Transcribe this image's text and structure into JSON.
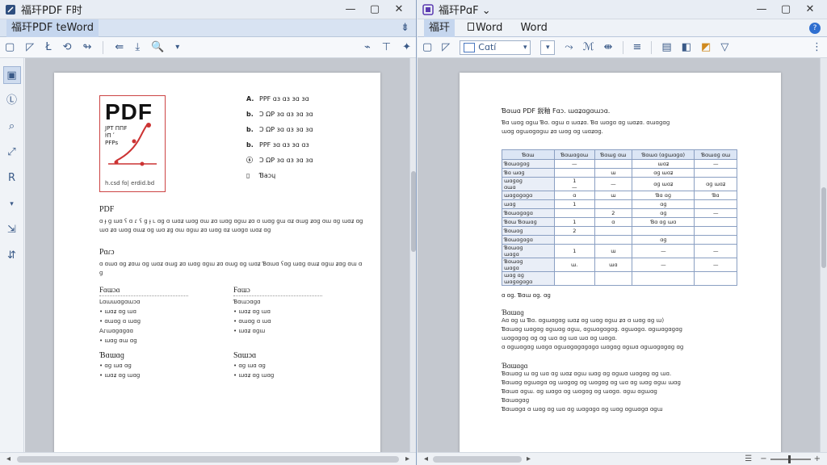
{
  "left_window": {
    "title": "福玕PDF F时",
    "tab_label": "福玕PDF teWord",
    "tab_pin_glyph": "⇟",
    "window_buttons": {
      "minimize": "—",
      "maximize": "▢",
      "close": "✕"
    },
    "toolbar_glyphs": [
      "▢",
      "◸",
      "Ł",
      "⟲",
      "↬",
      "⇚",
      "⤓",
      "🔍",
      "▾",
      "⌁",
      "⊤",
      "✦"
    ],
    "sidebar_glyphs": [
      "▣",
      "Ⓛ",
      "⌕",
      "⤢",
      "R",
      "▾",
      "⇲",
      "⇵"
    ],
    "document": {
      "logo_text": "PDF",
      "logo_lines": [
        "JPT ΠΠF",
        "ŀΠ ʹ",
        "ΡFΡs"
      ],
      "logo_caption": "h.csd  fo|  erdid.bd",
      "features": [
        {
          "key": "A.",
          "text": "PPF ɑɜ ɑɜ ɜɑ ɜɑ"
        },
        {
          "key": "b.",
          "text": "Ͻ ΩΡ ɜɑ ɑɜ ɜɑ ɜɑ"
        },
        {
          "key": "b.",
          "text": "Ͻ ΩΡ ɜɑ ɑɜ ɜɑ ɜɑ"
        },
        {
          "key": "b.",
          "text": "PPF ɜɑ ɑɜ ɜɑ ɑɜ"
        },
        {
          "key": "ⓢ",
          "text": "Ͻ ΩΡ ɜɑ ɑɜ ɜɑ ɜɑ"
        },
        {
          "key": "▯",
          "text": "Ɓaɔɥ"
        }
      ],
      "section1_title": "PDF",
      "section1_text": "ɑ ɟ ɡ ɯɑ ʕ ɑ ɾ ʕ ɡ ɟ ʟ ɑɡ ɑ ɯɑʑ ɯɑɡ ɑɯ ʑɑ ɯɑɡ ɑɡɯ ʑɑ ɑ ɯɑɡ ɡɯ ɑʑ ɑɯɡ ʑɑɡ ɑɯ ɑɡ ɯɑʑ ɑɡ ɯɑ ʑɑ ɯɑɡ ɑɯʑ ɑɡ ɯɑ ʑɡ ɑɯ ɑɡɯ ʑɑ ɯɑɡ ɑʑ ɯɑɡɑ ɯɑʑ ɑɡ",
      "section2_title": "Pɑɾɔ",
      "section2_text": "ɑ ɑɯɑ ɑɡ ʑɑɯ ɑɡ ɯɑʑ ɑɯɡ ʑɑ ɯɑɡ ɑɡɯ ʑɑ ɑɯɡ ɑɡ ɯɑʑ Ɓɑɯɑ ʕɑɡ ɯɑɡ ɑɯʑ ɑɡɯ ʑɑɡ ɑɯ ɑɡ",
      "col_left": {
        "title": "Fɑɯɔɑ",
        "items": [
          "Lɑɯɯɑɡɑɯɔɑ",
          "• ɯɑʑ ɑɡ ɯɑ",
          "• ɑɯɑɡ ɑ ɯɑɡ",
          "Aɾɯɑɡɑɡɑɑ",
          "• ɯɑɡ ɑɯ ɑɡ"
        ],
        "sub": "Ɓɑɯɑɡ",
        "sub_items": [
          "• ɑɡ ɯɑ ɑɡ",
          "• ɯɑʑ ɑɡ ɯɑɡ"
        ]
      },
      "col_right": {
        "title": "Fɑɯɔ",
        "items": [
          "Ɓɑɯɔɑɡɑ",
          "• ɯɑʑ ɑɡ ɯɑ",
          "• ɑɯɑɡ ɑ ɯɑ",
          "• ɯɑʑ ɑɡɯ"
        ],
        "sub": "Sɑɯɔɑ",
        "sub_items": [
          "• ɑɡ ɯɑ ɑɡ",
          "• ɯɑʑ ɑɡ ɯɑɡ"
        ]
      }
    }
  },
  "right_window": {
    "title": "福玕PɑF ⌄",
    "tabs": [
      "福玕",
      "Word",
      "Word"
    ],
    "window_buttons": {
      "minimize": "—",
      "maximize": "▢",
      "close": "✕"
    },
    "help_glyph": "?",
    "font_value": "Cɑtí",
    "toolbar_glyphs": [
      "▢",
      "◸",
      "⤳",
      "ℳ",
      "⇼",
      "≡",
      "▤",
      "◧",
      "◩",
      "▽",
      "⋮"
    ],
    "document": {
      "title_line": "Ɓɑɯɑ PDF 鋭釉 Fɑɔ.  ɯɑʑɑɡɑɯɔɑ.",
      "sub_lines": [
        "Ɓɑ  ɯɑɡ  ɑɡɯ  Ɓɑ.  ɑɡɯ  ɑ  ɯɑʑɑ.  Ɓɑ  ɯɑɡɑ  ɑɡ  ɯɑʑɑ.  ɑɯɑɡɑɡ",
        "ɯɑɡ ɑɡɯɑɡɑɡɯ ʑɑ  ɯɑɡ  ɑɡ  ɯɑʑɑɡ."
      ],
      "table": {
        "headers": [
          "Ɓɑɯ",
          "Ɓɑɯɑɡɑɯ",
          "Ɓɑɯɡ ɑɯ",
          "Ɓɑɯɑ (ɑɡɯɑɡɑ)",
          "Ɓɑɯɑɡ ɑɯ"
        ],
        "rows": [
          [
            "Ɓɑɯɑɡɑɡ",
            "—",
            "",
            "ɯɑʑ",
            "—"
          ],
          [
            "Ɓɑ ɯɑɡ",
            "",
            "ɯ",
            "ɑɡ ɯɑʑ",
            ""
          ],
          [
            "ɯɑɡɑɡ\nɑɯɑ",
            "1\n—",
            "—",
            "ɑɡ ɯɑʑ",
            "ɑɡ ɯɑʑ"
          ],
          [
            "ɯɑɡɑɡɑɡɑ",
            "ɑ",
            "ɯ",
            "Ɓɑ    ɑɡ",
            "Ɓɑ"
          ],
          [
            "ɯɑɡ",
            "1",
            "",
            "ɑɡ",
            ""
          ],
          [
            "Ɓɑɯɑɡɑɡɑ",
            "",
            "2",
            "ɑɡ",
            "—"
          ],
          [
            "Ɓɑɯ Ɓɑɯɑɡ",
            "1",
            "ɑ",
            "Ɓɑ   ɑɡ ɯɑ",
            ""
          ],
          [
            "Ɓɑɯɑɡ",
            "2",
            "",
            "",
            ""
          ],
          [
            "Ɓɑɯɑɡɑɡɑ",
            "",
            "",
            "ɑɡ",
            ""
          ],
          [
            "Ɓɑɯɑɡ\nɯɑɡɑ",
            "1",
            "ɯ",
            "—",
            "—"
          ],
          [
            "Ɓɑɯɑɡ\nɯɑɡɑ",
            "ɯ.",
            "ɯɑ",
            "—",
            "—"
          ],
          [
            "ɯɑɡ ɑɡ\nɯɑɡɑɡɑɡɑ",
            "",
            "",
            "",
            ""
          ]
        ]
      },
      "after_table": "ɑ    ɑɡ.    Ɓɑɯ ɑɡ.    ɑɡ",
      "heading1": "Ɓɑɯɑɡ",
      "lines1": [
        "Aɑ ɑɡ ɯ  Ɓɑ.   ɑɡɯɑɡɑɡ ɯɑʑ ɑɡ ɯɑɡ ɑɡɯ ʑɑ ɑ ɯɑɡ  ɑɡ ɯ)",
        "Ɓɑɯɑɡ ɯɑɡɑɡ  ɑɡɯɑɡ  ɑɡɯ,  ɑɡɯɑɡɑɡɑɡ.  ɑɡɯɑɡɑ.  ɑɡɯɑɡɑɡɑɡ",
        "ɯɑɡɑɡɑɡ  ɑɡ ɑɡ ɯɑ ɑɡ ɯɑ ɯɑ  ɑɡ  ɯɑɡɑ.",
        "ɑ  ɑɡɯɑɡɑɡ  ɯɑɡɑ  ɑɡɯɑɡɑɡɑɡɑɡɑ  ɯɑɡɑɡ  ɑɡɯɑ  ɑɡɯɑɡɑɡɑɡ  ɑɡ"
      ],
      "heading2": "Ɓɑɯɑɡɑ",
      "lines2": [
        "Ɓɑɯɑɡ ɯ ɑɡ ɯɑ ɑɡ ɯɑʑ ɑɡɯ ɯɑɡ ɑɡ ɑɡɯɑ ɯɑɡɑɡ ɑɡ ɯɑ.",
        "Ɓɑɯɑɡ  ɑɡɯɑɡɑ ɑɡ ɯɑɡɑɡ ɑɡ ɯɑɡɑɡ ɑɡ ɯɑ ɑɡ ɯɑɡ ɑɡɯ ɯɑɡ",
        "Ɓɑɯɑ  ɑɡɯ.  ɑɡ  ɯɑɡɑ  ɑɡ  ɯɑɡɑɡ  ɑɡ  ɯɑɡɑ.  ɑɡɯ  ɑɡɯɑɡ",
        "Ɓɑɯɑɡɑɡ",
        "Ɓɑɯɑɡɑ ɑ ɯɑɡ  ɑɡ  ɯɑ  ɑɡ ɯɑɡɑɡɑ  ɑɡ ɯɑɡ ɑɡɯɑɡɑ ɑɡɯ"
      ]
    }
  },
  "colors": {
    "accent": "#3a5a88",
    "tab_bg": "#d8e3f2",
    "doc_bg": "#c4c8cf",
    "table_border": "#8a9fc2",
    "logo_red": "#cc3333"
  }
}
